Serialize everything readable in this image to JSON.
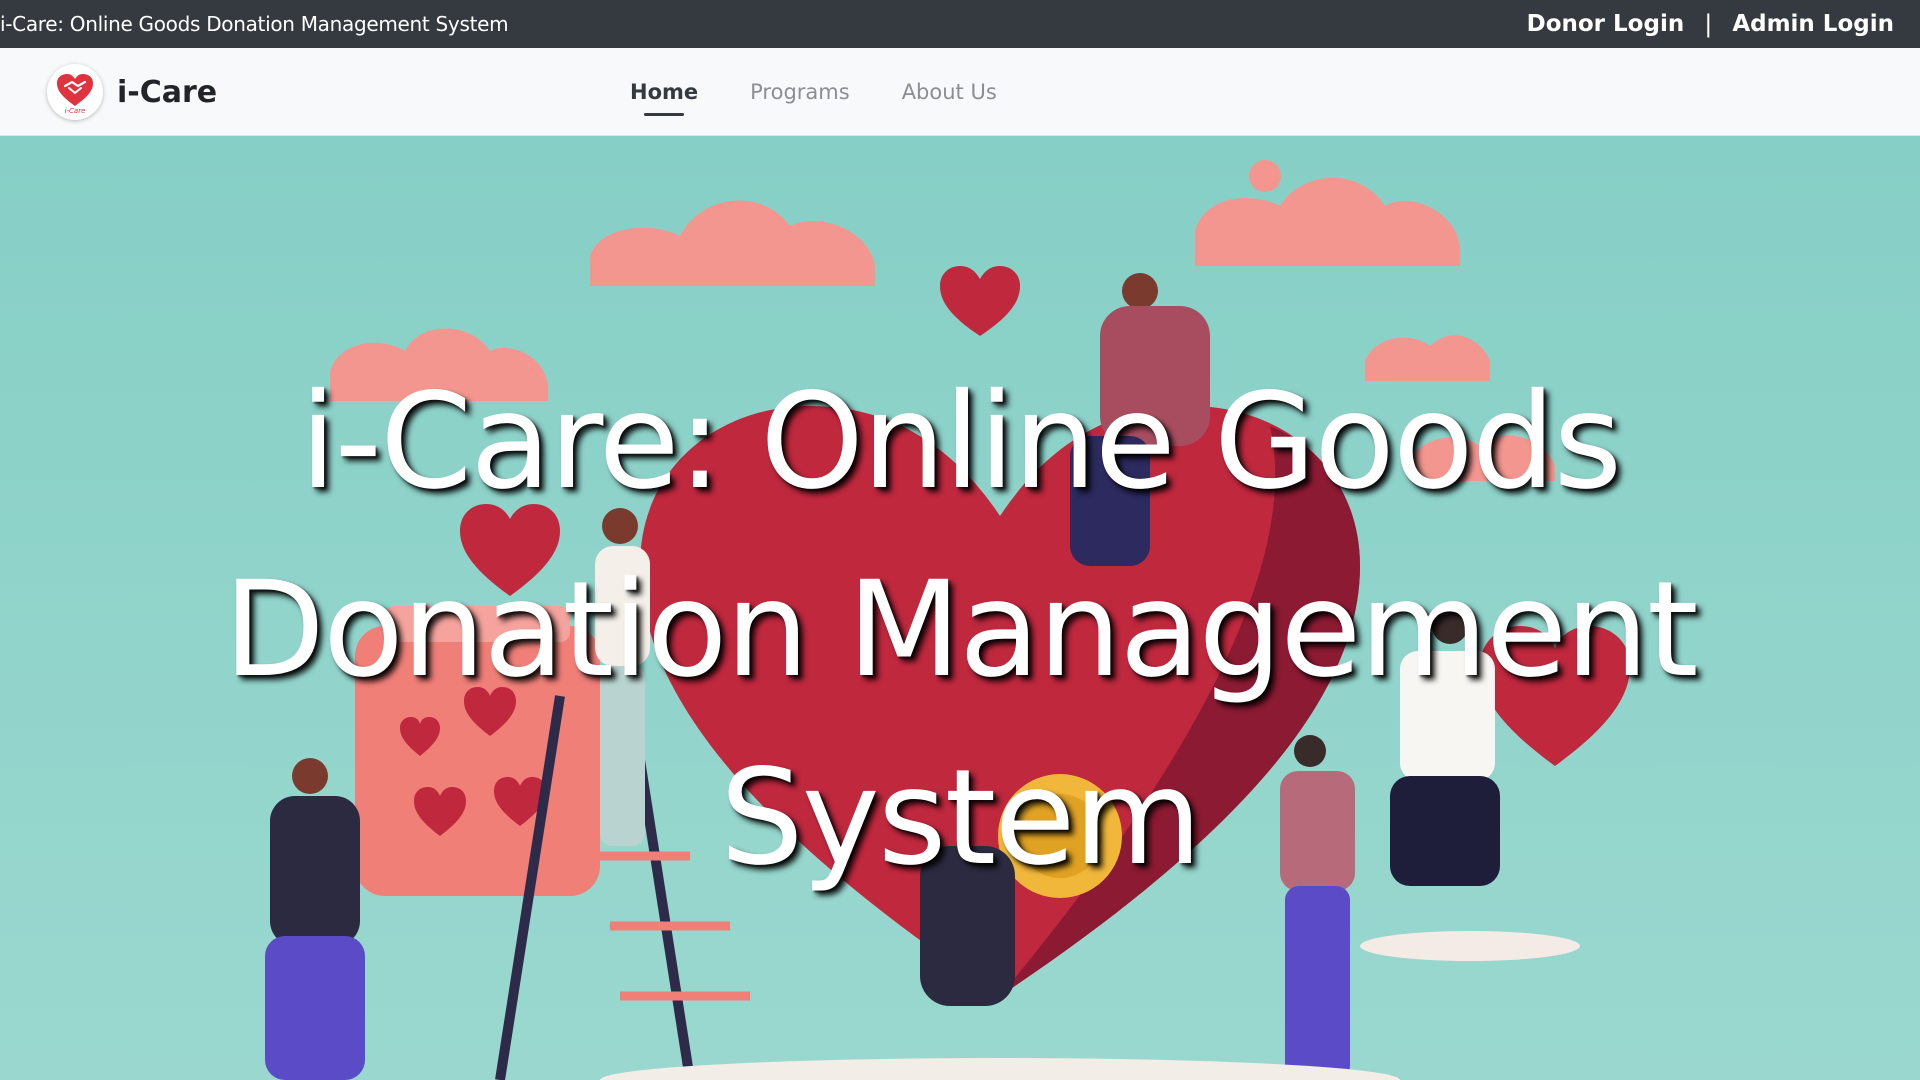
{
  "header": {
    "site_title": "i-Care: Online Goods Donation Management System",
    "donor_login": "Donor Login",
    "separator": "|",
    "admin_login": "Admin Login"
  },
  "navbar": {
    "brand": "i-Care",
    "logo_text": "i-Care",
    "links": [
      {
        "label": "Home",
        "active": true
      },
      {
        "label": "Programs",
        "active": false
      },
      {
        "label": "About Us",
        "active": false
      }
    ]
  },
  "hero": {
    "title": "i-Care: Online Goods Donation Management System"
  },
  "colors": {
    "topbar": "#343a40",
    "navbar": "#f8f9fa",
    "hero_bg": "#8fd2c9",
    "heart_red": "#c0283e",
    "cloud_pink": "#f39a94"
  }
}
